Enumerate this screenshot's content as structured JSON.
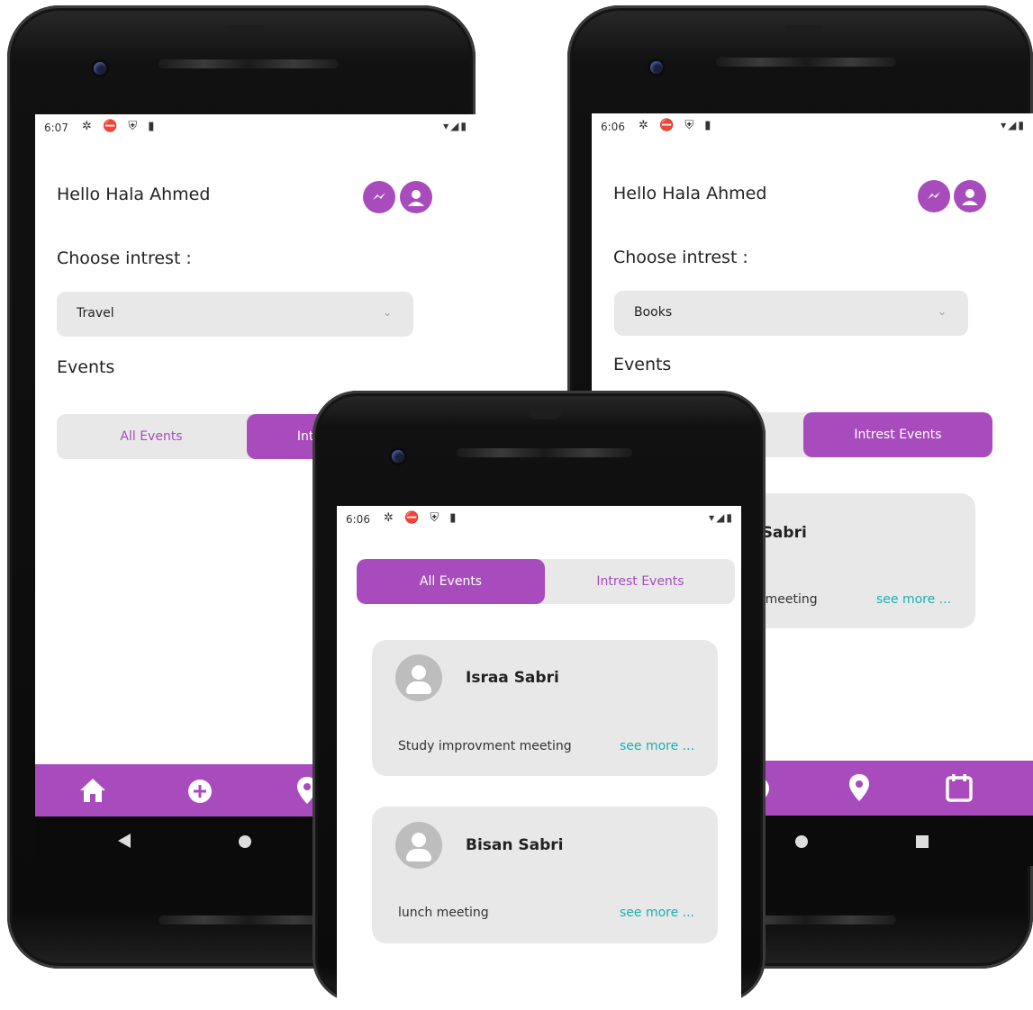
{
  "phone_left": {
    "status": {
      "time": "6:07",
      "icons": "✲ ⛔ ⛨ ▮",
      "right": "▾◢▮"
    },
    "greeting": "Hello Hala Ahmed",
    "choose_label": "Choose intrest :",
    "dropdown_value": "Travel",
    "events_label": "Events",
    "tabs": {
      "all": "All Events",
      "interest": "Intrest Events"
    },
    "active_tab": "interest"
  },
  "phone_right": {
    "status": {
      "time": "6:06",
      "icons": "✲ ⛔ ⛨ ▮",
      "right": "▾◢▮"
    },
    "greeting": "Hello Hala Ahmed",
    "choose_label": "Choose intrest :",
    "dropdown_value": "Books",
    "events_label": "Events",
    "tabs": {
      "all": "All Events",
      "interest": "Intrest Events"
    },
    "active_tab": "interest",
    "card": {
      "name": "Israa Sabri",
      "desc": "Study improvment meeting",
      "see_more": "see more ..."
    }
  },
  "phone_center": {
    "status": {
      "time": "6:06",
      "icons": "✲ ⛔ ⛨ ▮",
      "right": "▾◢▮"
    },
    "tabs": {
      "all": "All Events",
      "interest": "Intrest Events"
    },
    "active_tab": "all",
    "events": [
      {
        "name": "Israa Sabri",
        "desc": "Study improvment meeting",
        "see_more": "see more ..."
      },
      {
        "name": "Bisan Sabri",
        "desc": "lunch meeting",
        "see_more": "see more ..."
      }
    ]
  },
  "colors": {
    "accent": "#a84cbd",
    "link": "#1ab0b0",
    "card_bg": "#e8e8e8"
  },
  "icons": {
    "header": [
      "messenger-icon",
      "profile-icon"
    ],
    "bottom_nav": [
      "home-icon",
      "add-icon",
      "location-icon",
      "calendar-icon"
    ],
    "system_nav": [
      "back-icon",
      "home-circle-icon",
      "recents-icon"
    ]
  }
}
